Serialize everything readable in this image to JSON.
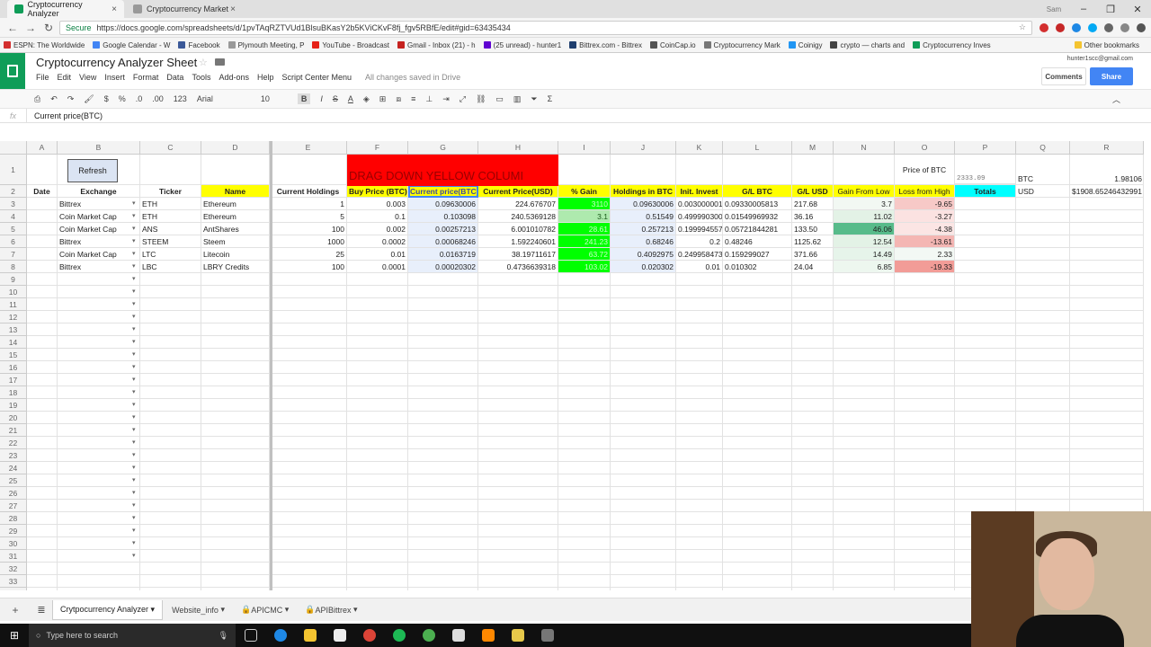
{
  "browser": {
    "tabs": [
      {
        "label": "Cryptocurrency Analyzer",
        "close": "×"
      },
      {
        "label": "Cryptocurrency Market",
        "close": "×"
      }
    ],
    "profile_label": "Sam",
    "url": "https://docs.google.com/spreadsheets/d/1pvTAqRZTVUd1BlsuBKasY2b5KViCKvF8fj_fgv5RBfE/edit#gid=63435434",
    "secure_label": "Secure",
    "bookmarks": [
      "ESPN: The Worldwide",
      "Google Calendar - W",
      "Facebook",
      "Plymouth Meeting, P",
      "YouTube - Broadcast",
      "Gmail - Inbox (21) - h",
      "(25 unread) - hunter1",
      "Bittrex.com - Bittrex",
      "CoinCap.io",
      "Cryptocurrency Mark",
      "Coinigy",
      "crypto — charts and",
      "Cryptocurrency Inves",
      "Other bookmarks"
    ]
  },
  "doc": {
    "title": "Cryptocurrency Analyzer Sheet",
    "menu": [
      "File",
      "Edit",
      "View",
      "Insert",
      "Format",
      "Data",
      "Tools",
      "Add-ons",
      "Help",
      "Script Center Menu"
    ],
    "save_status": "All changes saved in Drive",
    "user_email": "hunter1scc@gmail.com",
    "comments_label": "Comments",
    "share_label": "Share"
  },
  "toolbar": {
    "zoom_or_format": "123",
    "currency": "$",
    "percent": "%",
    "dec_less": ".0",
    "dec_more": ".00",
    "font": "Arial",
    "font_size": "10",
    "bold": "B",
    "italic": "I",
    "strike": "S",
    "text_color": "A",
    "sigma": "Σ"
  },
  "formula_bar": {
    "label": "fx",
    "content": "Current price(BTC)"
  },
  "grid": {
    "columns": [
      "A",
      "B",
      "C",
      "D",
      "E",
      "F",
      "G",
      "H",
      "I",
      "J",
      "K",
      "L",
      "M",
      "N",
      "O",
      "P",
      "Q",
      "R"
    ],
    "row_numbers": [
      "1",
      "2",
      "3",
      "4",
      "5",
      "6",
      "7",
      "8",
      "9",
      "10",
      "11",
      "12",
      "13",
      "14",
      "15",
      "16",
      "17",
      "18",
      "19",
      "20",
      "21",
      "22",
      "23",
      "24",
      "25",
      "26",
      "27",
      "28",
      "29",
      "30",
      "31",
      "32",
      "33",
      "34"
    ],
    "refresh_label": "Refresh",
    "banner": "DRAG DOWN YELLOW COLUMI",
    "price_of_btc_label": "Price of BTC",
    "btc_price": "2333.09",
    "btc_label": "BTC",
    "btc_ratio": "1.98106",
    "headers": [
      "Date",
      "Exchange",
      "Ticker",
      "Name",
      "Current Holdings",
      "Buy Price (BTC)",
      "Current price(BTC)",
      "Current Price(USD)",
      "% Gain",
      "Holdings in BTC",
      "Init. Invest",
      "G/L BTC",
      "G/L USD",
      "Gain From Low",
      "Loss from High",
      "Totals",
      "USD",
      "$1908.65246432991"
    ],
    "rows": [
      [
        "",
        "Bittrex",
        "ETH",
        "Ethereum",
        "1",
        "0.003",
        "0.09630006",
        "224.676707",
        "3110",
        "0.09630006",
        "0.003000001",
        "0.09330005813",
        "217.68",
        "3.7",
        "-9.65"
      ],
      [
        "",
        "Coin Market Cap",
        "ETH",
        "Ethereum",
        "5",
        "0.1",
        "0.103098",
        "240.5369128",
        "3.1",
        "0.51549",
        "0.499990300",
        "0.01549969932",
        "36.16",
        "11.02",
        "-3.27"
      ],
      [
        "",
        "Coin Market Cap",
        "ANS",
        "AntShares",
        "100",
        "0.002",
        "0.00257213",
        "6.001010782",
        "28.61",
        "0.257213",
        "0.199994557",
        "0.05721844281",
        "133.50",
        "46.06",
        "-4.38"
      ],
      [
        "",
        "Bittrex",
        "STEEM",
        "Steem",
        "1000",
        "0.0002",
        "0.00068246",
        "1.592240601",
        "241.23",
        "0.68246",
        "0.2",
        "0.48246",
        "1125.62",
        "12.54",
        "-13.61"
      ],
      [
        "",
        "Coin Market Cap",
        "LTC",
        "Litecoin",
        "25",
        "0.01",
        "0.0163719",
        "38.19711617",
        "63.72",
        "0.4092975",
        "0.249958473",
        "0.159299027",
        "371.66",
        "14.49",
        "2.33"
      ],
      [
        "",
        "Bittrex",
        "LBC",
        "LBRY Credits",
        "100",
        "0.0001",
        "0.00020302",
        "0.4736639318",
        "103.02",
        "0.020302",
        "0.01",
        "0.010302",
        "24.04",
        "6.85",
        "-19.33"
      ]
    ]
  },
  "sheet_tabs": [
    "Crytpocurrency Analyzer",
    "Website_info",
    "APICMC",
    "APIBittrex"
  ],
  "sheet_tab_add": "+",
  "taskbar": {
    "search_placeholder": "Type here to search",
    "start": "⊞"
  },
  "colors": {
    "sheets_green": "#0f9d58",
    "header_yellow": "#ffff00",
    "banner_red": "#ff0000",
    "totals_cyan": "#00ffff",
    "share_blue": "#4285f4"
  }
}
